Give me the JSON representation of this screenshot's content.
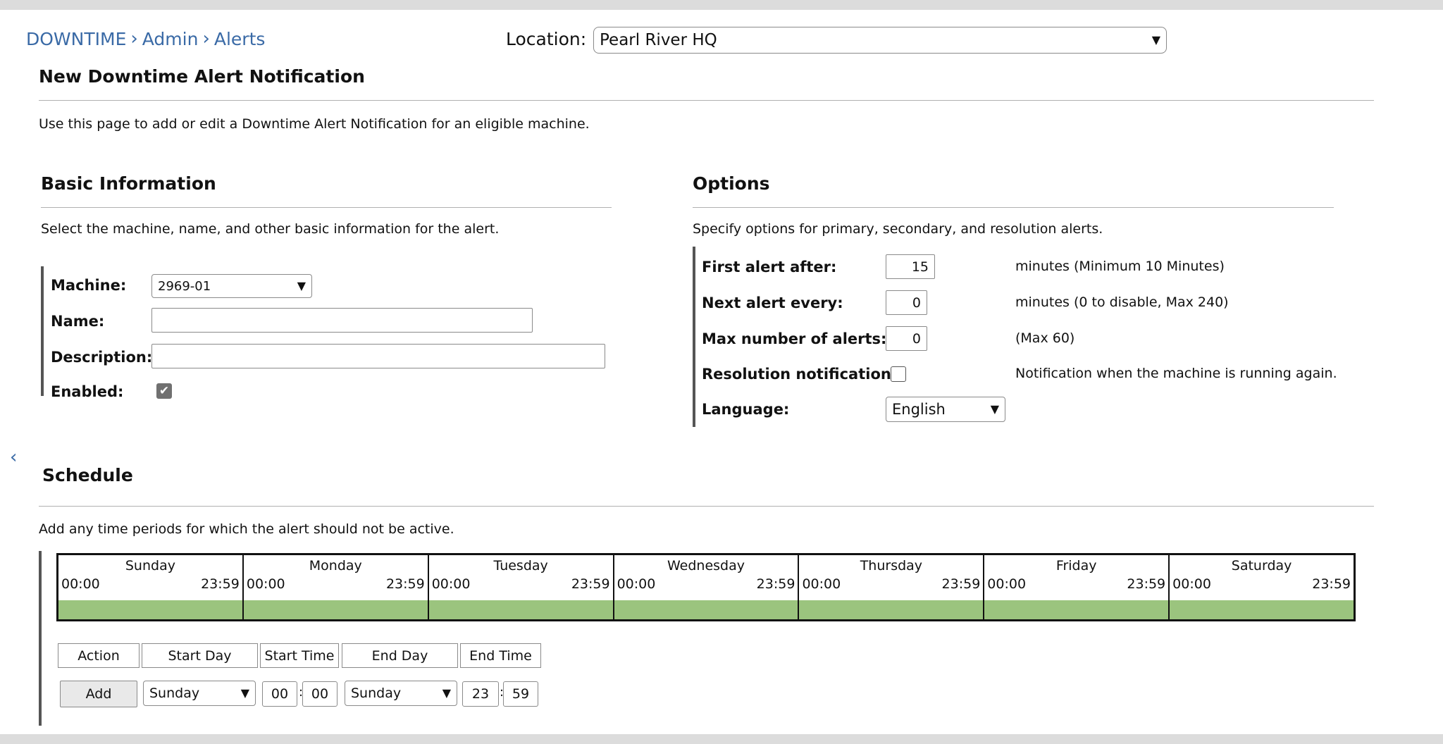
{
  "breadcrumb": {
    "items": [
      "DOWNTIME",
      "Admin",
      "Alerts"
    ]
  },
  "location": {
    "label": "Location:",
    "value": "Pearl River HQ"
  },
  "page": {
    "title": "New Downtime Alert Notification",
    "description": "Use this page to add or edit a Downtime Alert Notification for an eligible machine."
  },
  "basic": {
    "title": "Basic Information",
    "description": "Select the machine, name, and other basic information for the alert.",
    "machine_label": "Machine:",
    "machine_value": "2969-01",
    "name_label": "Name:",
    "name_value": "",
    "description_label": "Description:",
    "description_value": "",
    "enabled_label": "Enabled:",
    "enabled": true
  },
  "options": {
    "title": "Options",
    "description": "Specify options for primary, secondary, and resolution alerts.",
    "first_alert_label": "First alert after:",
    "first_alert_value": "15",
    "first_alert_note": "minutes (Minimum 10 Minutes)",
    "next_alert_label": "Next alert every:",
    "next_alert_value": "0",
    "next_alert_note": "minutes (0 to disable, Max 240)",
    "max_alerts_label": "Max number of alerts:",
    "max_alerts_value": "0",
    "max_alerts_note": "(Max 60)",
    "resolution_label": "Resolution notification:",
    "resolution_note": "Notification when the machine is running again.",
    "resolution_checked": false,
    "language_label": "Language:",
    "language_value": "English"
  },
  "schedule": {
    "title": "Schedule",
    "description": "Add any time periods for which the alert should not be active.",
    "days": [
      {
        "name": "Sunday",
        "start": "00:00",
        "end": "23:59"
      },
      {
        "name": "Monday",
        "start": "00:00",
        "end": "23:59"
      },
      {
        "name": "Tuesday",
        "start": "00:00",
        "end": "23:59"
      },
      {
        "name": "Wednesday",
        "start": "00:00",
        "end": "23:59"
      },
      {
        "name": "Thursday",
        "start": "00:00",
        "end": "23:59"
      },
      {
        "name": "Friday",
        "start": "00:00",
        "end": "23:59"
      },
      {
        "name": "Saturday",
        "start": "00:00",
        "end": "23:59"
      }
    ],
    "headers": [
      "Action",
      "Start Day",
      "Start Time",
      "End Day",
      "End Time"
    ],
    "add_label": "Add",
    "start_day": "Sunday",
    "start_hour": "00",
    "start_minute": "00",
    "end_day": "Sunday",
    "end_hour": "23",
    "end_minute": "59",
    "colon": ":",
    "active_color": "#9bc47e"
  },
  "icons": {
    "collapse": "chevron-left-icon",
    "dropdown": "chevron-down-icon",
    "breadcrumb_sep": "chevron-right-icon"
  }
}
